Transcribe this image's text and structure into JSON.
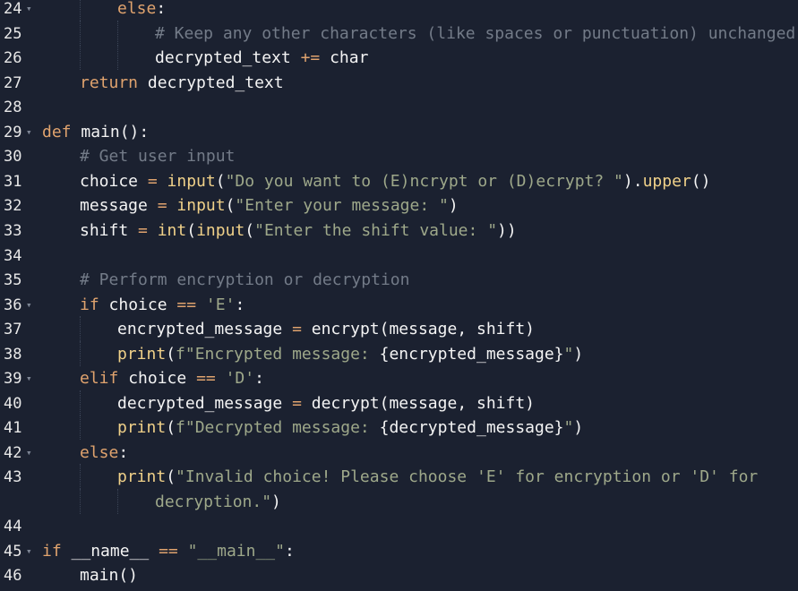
{
  "lines": [
    {
      "num": "24",
      "fold": true,
      "indent": 2,
      "tokens": [
        [
          "kw",
          "else"
        ],
        [
          "pl",
          ":"
        ]
      ]
    },
    {
      "num": "25",
      "fold": false,
      "indent": 3,
      "tokens": [
        [
          "cm",
          "# Keep any other characters (like spaces or punctuation) unchanged"
        ]
      ]
    },
    {
      "num": "26",
      "fold": false,
      "indent": 3,
      "tokens": [
        [
          "pl",
          "decrypted_text "
        ],
        [
          "op",
          "+="
        ],
        [
          "pl",
          " char"
        ]
      ]
    },
    {
      "num": "27",
      "fold": false,
      "indent": 1,
      "tokens": [
        [
          "kw",
          "return"
        ],
        [
          "pl",
          " decrypted_text"
        ]
      ]
    },
    {
      "num": "28",
      "fold": false,
      "indent": 0,
      "tokens": []
    },
    {
      "num": "29",
      "fold": true,
      "indent": 0,
      "tokens": [
        [
          "kw",
          "def"
        ],
        [
          "pl",
          " main():"
        ]
      ]
    },
    {
      "num": "30",
      "fold": false,
      "indent": 1,
      "tokens": [
        [
          "cm",
          "# Get user input"
        ]
      ]
    },
    {
      "num": "31",
      "fold": false,
      "indent": 1,
      "tokens": [
        [
          "pl",
          "choice "
        ],
        [
          "op",
          "="
        ],
        [
          "pl",
          " "
        ],
        [
          "fn",
          "input"
        ],
        [
          "pl",
          "("
        ],
        [
          "str",
          "\"Do you want to (E)ncrypt or (D)ecrypt? \""
        ],
        [
          "pl",
          ")."
        ],
        [
          "fn",
          "upper"
        ],
        [
          "pl",
          "()"
        ]
      ]
    },
    {
      "num": "32",
      "fold": false,
      "indent": 1,
      "tokens": [
        [
          "pl",
          "message "
        ],
        [
          "op",
          "="
        ],
        [
          "pl",
          " "
        ],
        [
          "fn",
          "input"
        ],
        [
          "pl",
          "("
        ],
        [
          "str",
          "\"Enter your message: \""
        ],
        [
          "pl",
          ")"
        ]
      ]
    },
    {
      "num": "33",
      "fold": false,
      "indent": 1,
      "tokens": [
        [
          "pl",
          "shift "
        ],
        [
          "op",
          "="
        ],
        [
          "pl",
          " "
        ],
        [
          "fn",
          "int"
        ],
        [
          "pl",
          "("
        ],
        [
          "fn",
          "input"
        ],
        [
          "pl",
          "("
        ],
        [
          "str",
          "\"Enter the shift value: \""
        ],
        [
          "pl",
          "))"
        ]
      ]
    },
    {
      "num": "34",
      "fold": false,
      "indent": 0,
      "tokens": []
    },
    {
      "num": "35",
      "fold": false,
      "indent": 1,
      "tokens": [
        [
          "cm",
          "# Perform encryption or decryption"
        ]
      ]
    },
    {
      "num": "36",
      "fold": true,
      "indent": 1,
      "tokens": [
        [
          "kw",
          "if"
        ],
        [
          "pl",
          " choice "
        ],
        [
          "op",
          "=="
        ],
        [
          "pl",
          " "
        ],
        [
          "str",
          "'E'"
        ],
        [
          "pl",
          ":"
        ]
      ]
    },
    {
      "num": "37",
      "fold": false,
      "indent": 2,
      "tokens": [
        [
          "pl",
          "encrypted_message "
        ],
        [
          "op",
          "="
        ],
        [
          "pl",
          " encrypt(message, shift)"
        ]
      ]
    },
    {
      "num": "38",
      "fold": false,
      "indent": 2,
      "tokens": [
        [
          "fn",
          "print"
        ],
        [
          "pl",
          "("
        ],
        [
          "str",
          "f\"Encrypted message: "
        ],
        [
          "pl",
          "{encrypted_message}"
        ],
        [
          "str",
          "\""
        ],
        [
          "pl",
          ")"
        ]
      ]
    },
    {
      "num": "39",
      "fold": true,
      "indent": 1,
      "tokens": [
        [
          "kw",
          "elif"
        ],
        [
          "pl",
          " choice "
        ],
        [
          "op",
          "=="
        ],
        [
          "pl",
          " "
        ],
        [
          "str",
          "'D'"
        ],
        [
          "pl",
          ":"
        ]
      ]
    },
    {
      "num": "40",
      "fold": false,
      "indent": 2,
      "tokens": [
        [
          "pl",
          "decrypted_message "
        ],
        [
          "op",
          "="
        ],
        [
          "pl",
          " decrypt(message, shift)"
        ]
      ]
    },
    {
      "num": "41",
      "fold": false,
      "indent": 2,
      "tokens": [
        [
          "fn",
          "print"
        ],
        [
          "pl",
          "("
        ],
        [
          "str",
          "f\"Decrypted message: "
        ],
        [
          "pl",
          "{decrypted_message}"
        ],
        [
          "str",
          "\""
        ],
        [
          "pl",
          ")"
        ]
      ]
    },
    {
      "num": "42",
      "fold": true,
      "indent": 1,
      "tokens": [
        [
          "kw",
          "else"
        ],
        [
          "pl",
          ":"
        ]
      ]
    },
    {
      "num": "43",
      "fold": false,
      "indent": 2,
      "tokens": [
        [
          "fn",
          "print"
        ],
        [
          "pl",
          "("
        ],
        [
          "str",
          "\"Invalid choice! Please choose 'E' for encryption or 'D' for"
        ]
      ]
    },
    {
      "num": "",
      "fold": false,
      "indent": 3,
      "tokens": [
        [
          "str",
          "decryption.\""
        ],
        [
          "pl",
          ")"
        ]
      ]
    },
    {
      "num": "44",
      "fold": false,
      "indent": 0,
      "tokens": []
    },
    {
      "num": "45",
      "fold": true,
      "indent": 0,
      "tokens": [
        [
          "kw",
          "if"
        ],
        [
          "pl",
          " __name__ "
        ],
        [
          "op",
          "=="
        ],
        [
          "pl",
          " "
        ],
        [
          "str",
          "\"__main__\""
        ],
        [
          "pl",
          ":"
        ]
      ]
    },
    {
      "num": "46",
      "fold": false,
      "indent": 1,
      "tokens": [
        [
          "pl",
          "main()"
        ]
      ]
    }
  ],
  "colors": {
    "background": "#1b2130",
    "keyword": "#e0a36e",
    "function": "#f0d189",
    "string": "#9ea88a",
    "comment": "#737b88",
    "text": "#f4f4f4"
  }
}
